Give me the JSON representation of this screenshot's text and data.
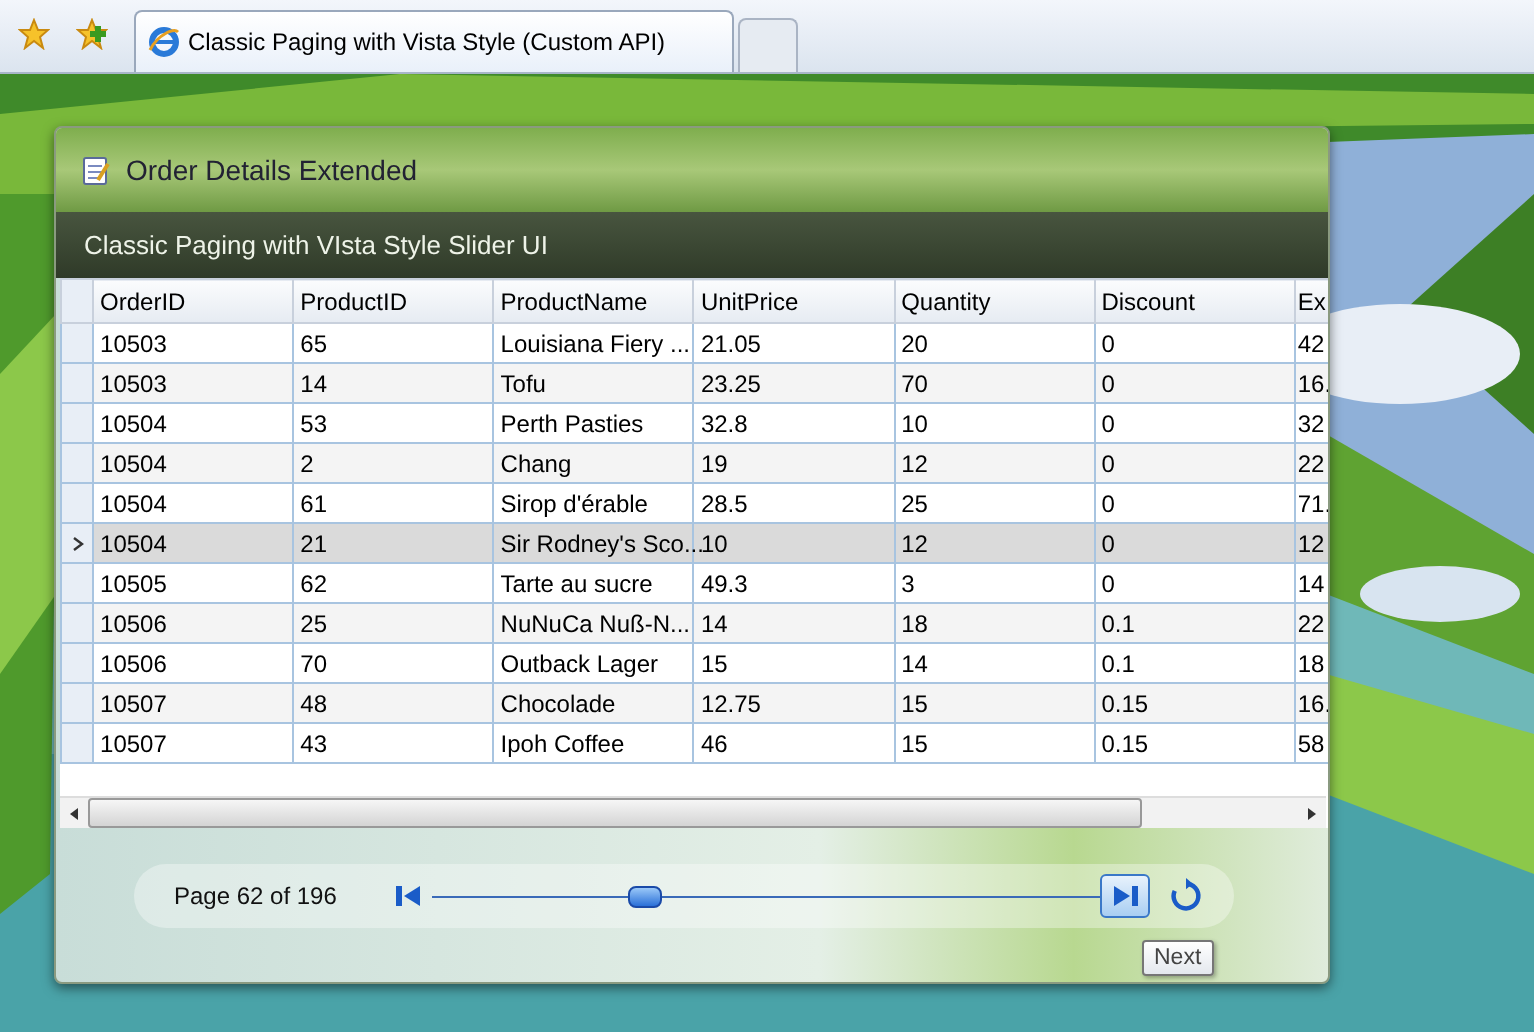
{
  "browser": {
    "tabs": [
      {
        "title": "Classic Paging with Vista Style (Custom API)",
        "selected": true
      }
    ]
  },
  "window": {
    "title": "Order Details Extended",
    "subtitle": "Classic Paging with VIsta Style Slider UI"
  },
  "table": {
    "columns": [
      "OrderID",
      "ProductID",
      "ProductName",
      "UnitPrice",
      "Quantity",
      "Discount",
      "Ex"
    ],
    "rows": [
      {
        "selected": false,
        "cells": [
          "10503",
          "65",
          "Louisiana Fiery ...",
          "21.05",
          "20",
          "0",
          "42"
        ]
      },
      {
        "selected": false,
        "cells": [
          "10503",
          "14",
          "Tofu",
          "23.25",
          "70",
          "0",
          "16."
        ]
      },
      {
        "selected": false,
        "cells": [
          "10504",
          "53",
          "Perth Pasties",
          "32.8",
          "10",
          "0",
          "32"
        ]
      },
      {
        "selected": false,
        "cells": [
          "10504",
          "2",
          "Chang",
          "19",
          "12",
          "0",
          "22"
        ]
      },
      {
        "selected": false,
        "cells": [
          "10504",
          "61",
          "Sirop d'érable",
          "28.5",
          "25",
          "0",
          "71."
        ]
      },
      {
        "selected": true,
        "cells": [
          "10504",
          "21",
          "Sir Rodney's Sco...",
          "10",
          "12",
          "0",
          "12"
        ]
      },
      {
        "selected": false,
        "cells": [
          "10505",
          "62",
          "Tarte au sucre",
          "49.3",
          "3",
          "0",
          "14"
        ]
      },
      {
        "selected": false,
        "cells": [
          "10506",
          "25",
          "NuNuCa Nuß-N...",
          "14",
          "18",
          "0.1",
          "22"
        ]
      },
      {
        "selected": false,
        "cells": [
          "10506",
          "70",
          "Outback Lager",
          "15",
          "14",
          "0.1",
          "18"
        ]
      },
      {
        "selected": false,
        "cells": [
          "10507",
          "48",
          "Chocolade",
          "12.75",
          "15",
          "0.15",
          "16."
        ]
      },
      {
        "selected": false,
        "cells": [
          "10507",
          "43",
          "Ipoh Coffee",
          "46",
          "15",
          "0.15",
          "58"
        ]
      }
    ]
  },
  "pager": {
    "label": "Page 62 of 196",
    "slider": {
      "level": 0.32
    },
    "tooltip": "Next"
  }
}
